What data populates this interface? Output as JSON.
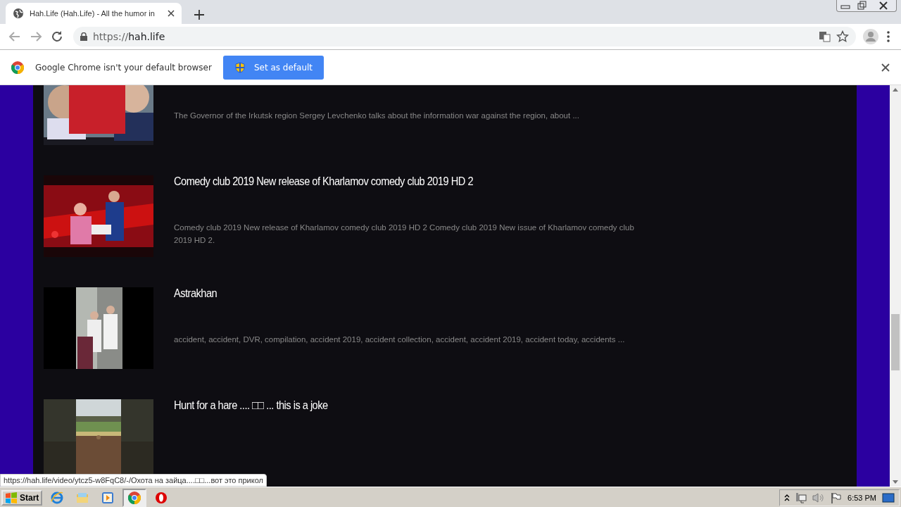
{
  "tab": {
    "title": "Hah.Life (Hah.Life) - All the humor in",
    "selected": true
  },
  "address_bar": {
    "url_scheme": "https://",
    "url_host": "hah.life"
  },
  "infobar": {
    "message": "Google Chrome isn't your default browser",
    "button": "Set as default"
  },
  "videos": [
    {
      "description": "The Governor of the Irkutsk region Sergey Levchenko talks about the information war against the region, about ..."
    },
    {
      "title": "Comedy club 2019 New release of Kharlamov comedy club 2019 HD 2",
      "description": "Comedy club 2019 New release of Kharlamov comedy club 2019 HD 2 Comedy club 2019 New issue of Kharlamov comedy club 2019 HD 2."
    },
    {
      "title": "Astrakhan",
      "description": "accident, accident, DVR, compilation, accident 2019, accident collection, accident, accident 2019, accident today, accidents ..."
    },
    {
      "title": "Hunt for a hare .... □□ ... this is a joke"
    }
  ],
  "status_bubble": "https://hah.life/video/ytcz5-w8FqC8/-/Охота на зайца....□□...вот это прикол",
  "taskbar": {
    "start": "Start",
    "clock": "6:53 PM"
  }
}
